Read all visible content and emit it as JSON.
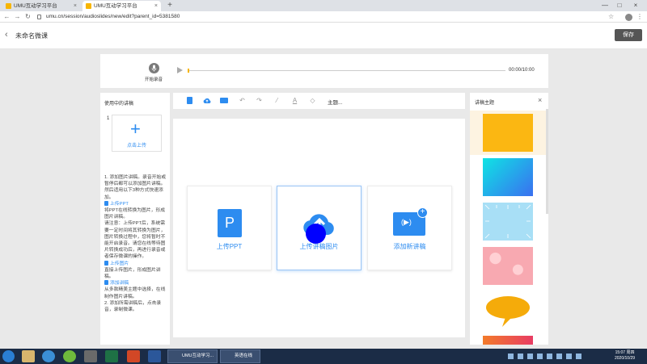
{
  "browser": {
    "tabs": [
      {
        "label": "UMU互动学习平台",
        "active": false
      },
      {
        "label": "UMU互动学习平台",
        "active": true
      }
    ],
    "new_tab": "+",
    "url": "umu.cn/session/audioslides/new/edit?parent_id=5381580",
    "window_controls": [
      "—",
      "□",
      "×"
    ],
    "nav": {
      "back": "←",
      "forward": "→",
      "reload": "↻"
    }
  },
  "header": {
    "title": "未命名微课",
    "save_label": "保存",
    "back_icon": "‹"
  },
  "recorder": {
    "record_label": "开始录音",
    "time": "00:00/10:00"
  },
  "left_panel": {
    "title": "使用中的讲稿",
    "slide_number": "1",
    "upload_label": "点击上传",
    "instructions": [
      {
        "text": "1. 添加图片讲稿。录音开始或暂停后都可以添加图片讲稿。然后适用以下3种方式快速添加。",
        "style": "normal",
        "icon": false
      },
      {
        "text": "上传PPT",
        "style": "blue",
        "icon": true
      },
      {
        "text": "将PPT在线转换为图片，形成图片讲稿。",
        "style": "normal",
        "icon": false
      },
      {
        "text": "请注意：上传PPT后，系统需要一定时间将其转换为图片，图片转换过程中，您将暂时不能开启录音。请您在线等待图片转换成功后，再进行录音或者保存微课的操作。",
        "style": "normal",
        "icon": false
      },
      {
        "text": "上传图片",
        "style": "blue",
        "icon": true
      },
      {
        "text": "直接上传图片，形成图片讲稿。",
        "style": "normal",
        "icon": false
      },
      {
        "text": "添加讲稿",
        "style": "blue",
        "icon": true
      },
      {
        "text": "从多款精美主题中选择，在线制作图片讲稿。",
        "style": "normal",
        "icon": false
      },
      {
        "text": "2. 添加所需讲稿后，点击录音，录制微课。",
        "style": "normal",
        "icon": false
      }
    ]
  },
  "toolbar": {
    "title_placeholder": "主题...",
    "tools": [
      "page-icon",
      "cloud-upload-icon",
      "image-icon",
      "undo-icon",
      "redo-icon",
      "brush-icon",
      "font-color-icon",
      "eraser-icon"
    ]
  },
  "canvas": {
    "options": [
      {
        "label": "上传PPT"
      },
      {
        "label": "上传讲稿图片"
      },
      {
        "label": "添加新讲稿"
      }
    ],
    "ppt_letter": "P",
    "add_badge": "+"
  },
  "right_panel": {
    "title": "讲稿主题",
    "close": "×",
    "themes": [
      "yellow",
      "cyan-blue-gradient",
      "light-blue-arrows",
      "pink-hearts",
      "speech-bubble",
      "orange-red-gradient"
    ]
  },
  "taskbar": {
    "browser_window_label": "UMU互动学习...",
    "app_window_label": "英语在线",
    "clock_time": "15:07 周四",
    "clock_date": "2020/10/29"
  },
  "colors": {
    "accent": "#2d8cf0",
    "brand_yellow": "#f7b500",
    "save_button": "#555555",
    "cursor_dot": "#0000ff"
  }
}
